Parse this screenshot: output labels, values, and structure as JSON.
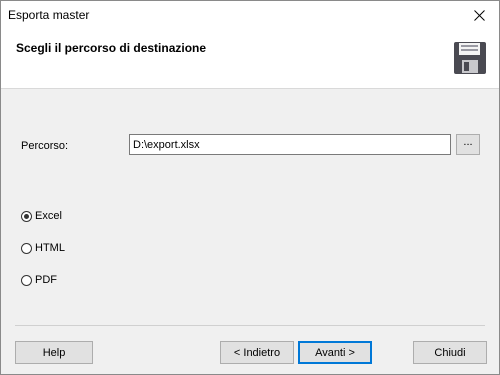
{
  "window": {
    "title": "Esporta master"
  },
  "header": {
    "title": "Scegli il percorso di destinazione"
  },
  "form": {
    "path_label": "Percorso:",
    "path_value": "D:\\export.xlsx",
    "browse_label": "..."
  },
  "format_options": [
    {
      "label": "Excel",
      "selected": true
    },
    {
      "label": "HTML",
      "selected": false
    },
    {
      "label": "PDF",
      "selected": false
    }
  ],
  "buttons": {
    "help": "Help",
    "back": "< Indietro",
    "next": "Avanti >",
    "close": "Chiudi"
  },
  "icons": {
    "close": "close-icon",
    "save": "floppy-disk-icon"
  },
  "colors": {
    "default_button_border": "#0078d7",
    "dialog_bg": "#f0f0f0"
  }
}
